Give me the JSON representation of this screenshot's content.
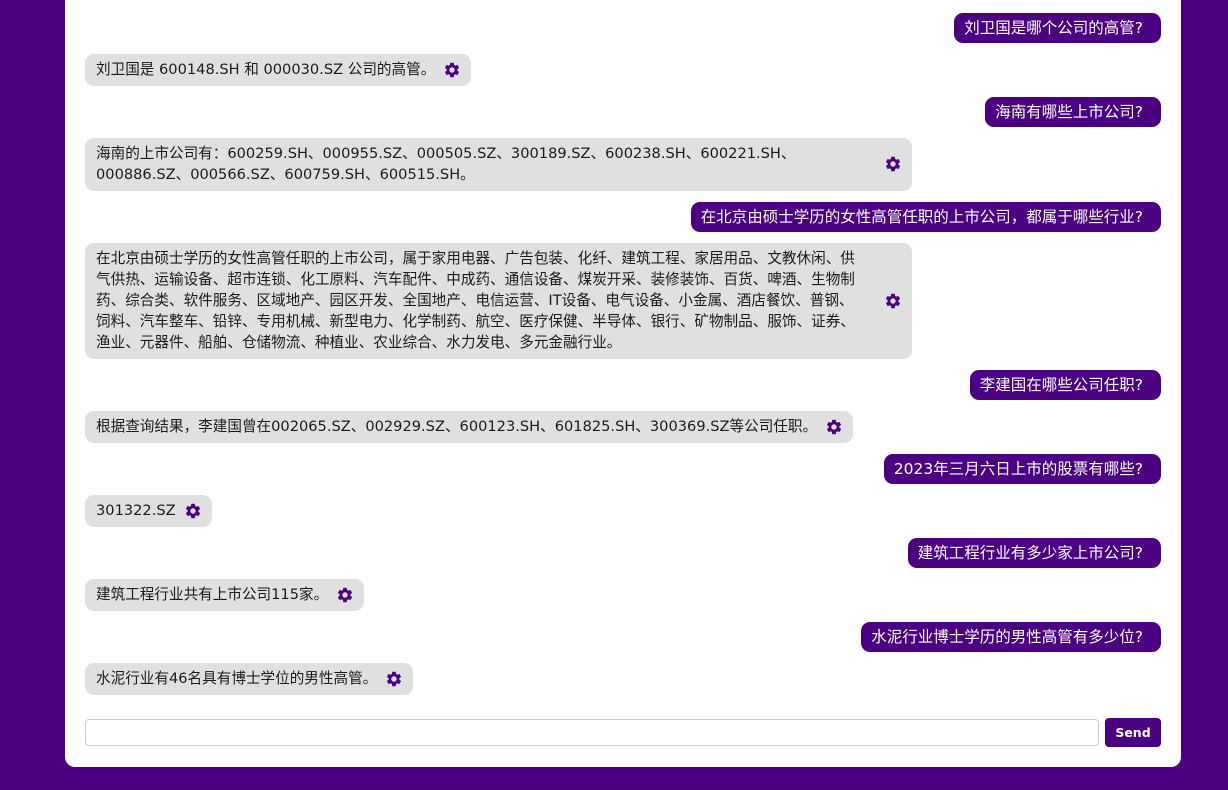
{
  "messages": [
    {
      "role": "user",
      "text": "刘卫国是哪个公司的高管?"
    },
    {
      "role": "bot",
      "text": "刘卫国是 600148.SH 和 000030.SZ 公司的高管。",
      "icon": "gear-icon"
    },
    {
      "role": "user",
      "text": "海南有哪些上市公司?"
    },
    {
      "role": "bot",
      "text": "海南的上市公司有：600259.SH、000955.SZ、000505.SZ、300189.SZ、600238.SH、600221.SH、000886.SZ、000566.SZ、600759.SH、600515.SH。",
      "icon": "gear-icon",
      "wide": true
    },
    {
      "role": "user",
      "text": "在北京由硕士学历的女性高管任职的上市公司，都属于哪些行业?"
    },
    {
      "role": "bot",
      "text": "在北京由硕士学历的女性高管任职的上市公司，属于家用电器、广告包装、化纤、建筑工程、家居用品、文教休闲、供气供热、运输设备、超市连锁、化工原料、汽车配件、中成药、通信设备、煤炭开采、装修装饰、百货、啤酒、生物制药、综合类、软件服务、区域地产、园区开发、全国地产、电信运营、IT设备、电气设备、小金属、酒店餐饮、普钢、饲料、汽车整车、铅锌、专用机械、新型电力、化学制药、航空、医疗保健、半导体、银行、矿物制品、服饰、证券、渔业、元器件、船舶、仓储物流、种植业、农业综合、水力发电、多元金融行业。",
      "icon": "gear-icon",
      "wide": true
    },
    {
      "role": "user",
      "text": "李建国在哪些公司任职?"
    },
    {
      "role": "bot",
      "text": "根据查询结果，李建国曾在002065.SZ、002929.SZ、600123.SH、601825.SH、300369.SZ等公司任职。",
      "icon": "gear-icon"
    },
    {
      "role": "user",
      "text": "2023年三月六日上市的股票有哪些?"
    },
    {
      "role": "bot",
      "text": "301322.SZ",
      "icon": "gear-icon"
    },
    {
      "role": "user",
      "text": "建筑工程行业有多少家上市公司?"
    },
    {
      "role": "bot",
      "text": "建筑工程行业共有上市公司115家。",
      "icon": "gear-icon"
    },
    {
      "role": "user",
      "text": "水泥行业博士学历的男性高管有多少位?"
    },
    {
      "role": "bot",
      "text": "水泥行业有46名具有博士学位的男性高管。",
      "icon": "gear-icon"
    }
  ],
  "composer": {
    "input_value": "",
    "input_placeholder": "",
    "send_label": "Send"
  },
  "colors": {
    "accent": "#4b0082",
    "bot_bubble": "#e0e0e0",
    "panel": "#ffffff"
  }
}
